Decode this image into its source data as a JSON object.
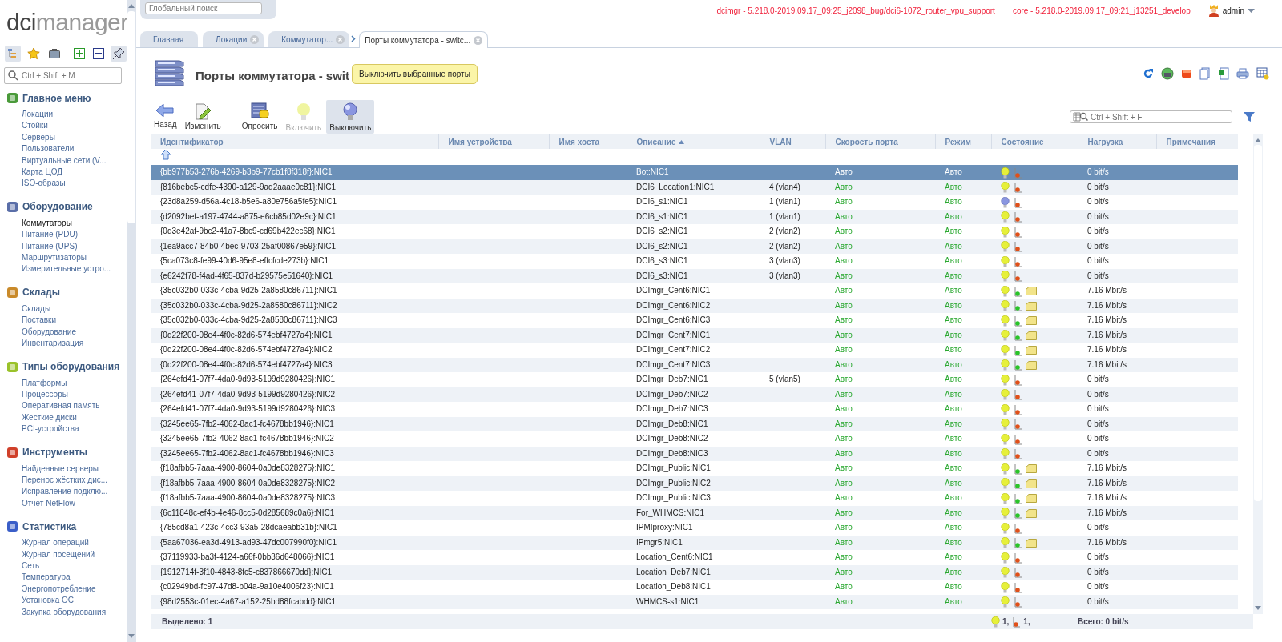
{
  "logo": {
    "strong": "dci",
    "light": "manager"
  },
  "sidebar": {
    "search": {
      "placeholder": "Ctrl + Shift + M"
    },
    "tools": [
      {
        "kind": "tree",
        "selected": true
      },
      {
        "kind": "star",
        "selected": false
      },
      {
        "kind": "case",
        "selected": false
      },
      {
        "kind": "expand",
        "selected": false
      },
      {
        "kind": "collapse",
        "selected": false
      },
      {
        "kind": "pin",
        "selected": true
      }
    ],
    "sections": [
      {
        "title": "Главное меню",
        "items": [
          {
            "label": "Локации",
            "selected": false
          },
          {
            "label": "Стойки",
            "selected": false
          },
          {
            "label": "Серверы",
            "selected": false
          },
          {
            "label": "Пользователи",
            "selected": false
          },
          {
            "label": "Виртуальные сети (V...",
            "selected": false
          },
          {
            "label": "Карта ЦОД",
            "selected": false
          },
          {
            "label": "ISO-образы",
            "selected": false
          }
        ]
      },
      {
        "title": "Оборудование",
        "items": [
          {
            "label": "Коммутаторы",
            "selected": true
          },
          {
            "label": "Питание (PDU)",
            "selected": false
          },
          {
            "label": "Питание (UPS)",
            "selected": false
          },
          {
            "label": "Маршрутизаторы",
            "selected": false
          },
          {
            "label": "Измерительные устро...",
            "selected": false
          }
        ]
      },
      {
        "title": "Склады",
        "items": [
          {
            "label": "Склады",
            "selected": false
          },
          {
            "label": "Поставки",
            "selected": false
          },
          {
            "label": "Оборудование",
            "selected": false
          },
          {
            "label": "Инвентаризация",
            "selected": false
          }
        ]
      },
      {
        "title": "Типы оборудования",
        "items": [
          {
            "label": "Платформы",
            "selected": false
          },
          {
            "label": "Процессоры",
            "selected": false
          },
          {
            "label": "Оперативная память",
            "selected": false
          },
          {
            "label": "Жесткие диски",
            "selected": false
          },
          {
            "label": "PCI-устройства",
            "selected": false
          }
        ]
      },
      {
        "title": "Инструменты",
        "items": [
          {
            "label": "Найденные серверы",
            "selected": false
          },
          {
            "label": "Перенос жёстких дис...",
            "selected": false
          },
          {
            "label": "Исправление подклю...",
            "selected": false
          },
          {
            "label": "Отчет NetFlow",
            "selected": false
          }
        ]
      },
      {
        "title": "Статистика",
        "items": [
          {
            "label": "Журнал операций",
            "selected": false
          },
          {
            "label": "Журнал посещений",
            "selected": false
          },
          {
            "label": "Сеть",
            "selected": false
          },
          {
            "label": "Температура",
            "selected": false
          },
          {
            "label": "Энергопотребление",
            "selected": false
          },
          {
            "label": "Установка ОС",
            "selected": false
          },
          {
            "label": "Закупка оборудования",
            "selected": false
          }
        ]
      }
    ]
  },
  "global_search": {
    "placeholder": "Глобальный поиск"
  },
  "versions": [
    "dcimgr - 5.218.0-2019.09.17_09:25_j2098_bug/dci6-1072_router_vpu_support",
    "core - 5.218.0-2019.09.17_09:21_j13251_develop"
  ],
  "user": "admin",
  "tabs": [
    {
      "label": "Главная",
      "closable": false,
      "selected": false
    },
    {
      "label": "Локации",
      "closable": true,
      "selected": false
    },
    {
      "label": "Коммутатор...",
      "closable": true,
      "selected": false
    },
    {
      "label": "Порты коммутатора - switc...",
      "closable": true,
      "selected": true
    }
  ],
  "page_title": "Порты коммутатора - swit",
  "tooltip": "Выключить выбранные порты",
  "toolbar": [
    {
      "kind": "back",
      "label": "Назад",
      "disabled": false,
      "hover": false
    },
    {
      "kind": "edit",
      "label": "Изменить",
      "disabled": false,
      "hover": false
    },
    {
      "kind": "poll",
      "label": "Опросить",
      "disabled": false,
      "hover": false
    },
    {
      "kind": "on",
      "label": "Включить",
      "disabled": true,
      "hover": false
    },
    {
      "kind": "off",
      "label": "Выключить",
      "disabled": false,
      "hover": true
    }
  ],
  "table_search": {
    "placeholder": "Ctrl + Shift + F"
  },
  "columns": [
    {
      "label": "Идентификатор",
      "sorted": false
    },
    {
      "label": "Имя устройства",
      "sorted": false
    },
    {
      "label": "Имя хоста",
      "sorted": false
    },
    {
      "label": "Описание",
      "sorted": true
    },
    {
      "label": "VLAN",
      "sorted": false
    },
    {
      "label": "Скорость порта",
      "sorted": false
    },
    {
      "label": "Режим",
      "sorted": false
    },
    {
      "label": "Состояние",
      "sorted": false
    },
    {
      "label": "Нагрузка",
      "sorted": false
    },
    {
      "label": "Примечания",
      "sorted": false
    }
  ],
  "rows": [
    {
      "id": "{bb977b53-276b-4269-b3b9-77cb1f8f318f}:NIC1",
      "desc": "Bot:NIC1",
      "vlan": "",
      "speed": "Авто",
      "mode": "Авто",
      "power": true,
      "link": false,
      "traffic": false,
      "load": "0 bit/s",
      "selected": true
    },
    {
      "id": "{816bebc5-cdfe-4390-a129-9ad2aaae0c81}:NIC1",
      "desc": "DCI6_Location1:NIC1",
      "vlan": "4 (vlan4)",
      "speed": "Авто",
      "mode": "Авто",
      "power": true,
      "link": false,
      "traffic": false,
      "load": "0 bit/s",
      "selected": false
    },
    {
      "id": "{23d8a259-d56a-4c18-b5e6-a80e756a5fe5}:NIC1",
      "desc": "DCI6_s1:NIC1",
      "vlan": "1 (vlan1)",
      "speed": "Авто",
      "mode": "Авто",
      "power": false,
      "link": false,
      "traffic": false,
      "load": "0 bit/s",
      "selected": false
    },
    {
      "id": "{d2092bef-a197-4744-a875-e6cb85d02e9c}:NIC1",
      "desc": "DCI6_s1:NIC1",
      "vlan": "1 (vlan1)",
      "speed": "Авто",
      "mode": "Авто",
      "power": true,
      "link": false,
      "traffic": false,
      "load": "0 bit/s",
      "selected": false
    },
    {
      "id": "{0d3e42af-9bc2-41a7-8bc9-cd69b422ec68}:NIC1",
      "desc": "DCI6_s2:NIC1",
      "vlan": "2 (vlan2)",
      "speed": "Авто",
      "mode": "Авто",
      "power": true,
      "link": false,
      "traffic": false,
      "load": "0 bit/s",
      "selected": false
    },
    {
      "id": "{1ea9acc7-84b0-4bec-9703-25af00867e59}:NIC1",
      "desc": "DCI6_s2:NIC1",
      "vlan": "2 (vlan2)",
      "speed": "Авто",
      "mode": "Авто",
      "power": true,
      "link": false,
      "traffic": false,
      "load": "0 bit/s",
      "selected": false
    },
    {
      "id": "{5ca073c8-fe99-40d6-95e8-effcfcde273b}:NIC1",
      "desc": "DCI6_s3:NIC1",
      "vlan": "3 (vlan3)",
      "speed": "Авто",
      "mode": "Авто",
      "power": true,
      "link": false,
      "traffic": false,
      "load": "0 bit/s",
      "selected": false
    },
    {
      "id": "{e6242f78-f4ad-4f65-837d-b29575e51640}:NIC1",
      "desc": "DCI6_s3:NIC1",
      "vlan": "3 (vlan3)",
      "speed": "Авто",
      "mode": "Авто",
      "power": true,
      "link": false,
      "traffic": false,
      "load": "0 bit/s",
      "selected": false
    },
    {
      "id": "{35c032b0-033c-4cba-9d25-2a8580c86711}:NIC1",
      "desc": "DCImgr_Cent6:NIC1",
      "vlan": "",
      "speed": "Авто",
      "mode": "Авто",
      "power": true,
      "link": true,
      "traffic": true,
      "load": "7.16 Mbit/s",
      "selected": false
    },
    {
      "id": "{35c032b0-033c-4cba-9d25-2a8580c86711}:NIC2",
      "desc": "DCImgr_Cent6:NIC2",
      "vlan": "",
      "speed": "Авто",
      "mode": "Авто",
      "power": true,
      "link": true,
      "traffic": true,
      "load": "7.16 Mbit/s",
      "selected": false
    },
    {
      "id": "{35c032b0-033c-4cba-9d25-2a8580c86711}:NIC3",
      "desc": "DCImgr_Cent6:NIC3",
      "vlan": "",
      "speed": "Авто",
      "mode": "Авто",
      "power": true,
      "link": true,
      "traffic": true,
      "load": "7.16 Mbit/s",
      "selected": false
    },
    {
      "id": "{0d22f200-08e4-4f0c-82d6-574ebf4727a4}:NIC1",
      "desc": "DCImgr_Cent7:NIC1",
      "vlan": "",
      "speed": "Авто",
      "mode": "Авто",
      "power": true,
      "link": true,
      "traffic": true,
      "load": "7.16 Mbit/s",
      "selected": false
    },
    {
      "id": "{0d22f200-08e4-4f0c-82d6-574ebf4727a4}:NIC2",
      "desc": "DCImgr_Cent7:NIC2",
      "vlan": "",
      "speed": "Авто",
      "mode": "Авто",
      "power": true,
      "link": true,
      "traffic": true,
      "load": "7.16 Mbit/s",
      "selected": false
    },
    {
      "id": "{0d22f200-08e4-4f0c-82d6-574ebf4727a4}:NIC3",
      "desc": "DCImgr_Cent7:NIC3",
      "vlan": "",
      "speed": "Авто",
      "mode": "Авто",
      "power": true,
      "link": true,
      "traffic": true,
      "load": "7.16 Mbit/s",
      "selected": false
    },
    {
      "id": "{264efd41-07f7-4da0-9d93-5199d9280426}:NIC1",
      "desc": "DCImgr_Deb7:NIC1",
      "vlan": "5 (vlan5)",
      "speed": "Авто",
      "mode": "Авто",
      "power": true,
      "link": false,
      "traffic": false,
      "load": "0 bit/s",
      "selected": false
    },
    {
      "id": "{264efd41-07f7-4da0-9d93-5199d9280426}:NIC2",
      "desc": "DCImgr_Deb7:NIC2",
      "vlan": "",
      "speed": "Авто",
      "mode": "Авто",
      "power": true,
      "link": false,
      "traffic": false,
      "load": "0 bit/s",
      "selected": false
    },
    {
      "id": "{264efd41-07f7-4da0-9d93-5199d9280426}:NIC3",
      "desc": "DCImgr_Deb7:NIC3",
      "vlan": "",
      "speed": "Авто",
      "mode": "Авто",
      "power": true,
      "link": false,
      "traffic": false,
      "load": "0 bit/s",
      "selected": false
    },
    {
      "id": "{3245ee65-7fb2-4062-8ac1-fc4678bb1946}:NIC1",
      "desc": "DCImgr_Deb8:NIC1",
      "vlan": "",
      "speed": "Авто",
      "mode": "Авто",
      "power": true,
      "link": false,
      "traffic": false,
      "load": "0 bit/s",
      "selected": false
    },
    {
      "id": "{3245ee65-7fb2-4062-8ac1-fc4678bb1946}:NIC2",
      "desc": "DCImgr_Deb8:NIC2",
      "vlan": "",
      "speed": "Авто",
      "mode": "Авто",
      "power": true,
      "link": false,
      "traffic": false,
      "load": "0 bit/s",
      "selected": false
    },
    {
      "id": "{3245ee65-7fb2-4062-8ac1-fc4678bb1946}:NIC3",
      "desc": "DCImgr_Deb8:NIC3",
      "vlan": "",
      "speed": "Авто",
      "mode": "Авто",
      "power": true,
      "link": false,
      "traffic": false,
      "load": "0 bit/s",
      "selected": false
    },
    {
      "id": "{f18afbb5-7aaa-4900-8604-0a0de8328275}:NIC1",
      "desc": "DCImgr_Public:NIC1",
      "vlan": "",
      "speed": "Авто",
      "mode": "Авто",
      "power": true,
      "link": true,
      "traffic": true,
      "load": "7.16 Mbit/s",
      "selected": false
    },
    {
      "id": "{f18afbb5-7aaa-4900-8604-0a0de8328275}:NIC2",
      "desc": "DCImgr_Public:NIC2",
      "vlan": "",
      "speed": "Авто",
      "mode": "Авто",
      "power": true,
      "link": true,
      "traffic": true,
      "load": "7.16 Mbit/s",
      "selected": false
    },
    {
      "id": "{f18afbb5-7aaa-4900-8604-0a0de8328275}:NIC3",
      "desc": "DCImgr_Public:NIC3",
      "vlan": "",
      "speed": "Авто",
      "mode": "Авто",
      "power": true,
      "link": true,
      "traffic": true,
      "load": "7.16 Mbit/s",
      "selected": false
    },
    {
      "id": "{6c11848c-ef4b-4e46-8cc5-0d285689c0a6}:NIC1",
      "desc": "For_WHMCS:NIC1",
      "vlan": "",
      "speed": "Авто",
      "mode": "Авто",
      "power": true,
      "link": true,
      "traffic": true,
      "load": "7.16 Mbit/s",
      "selected": false
    },
    {
      "id": "{785cd8a1-423c-4cc3-93a5-28dcaeabb31b}:NIC1",
      "desc": "IPMIproxy:NIC1",
      "vlan": "",
      "speed": "Авто",
      "mode": "Авто",
      "power": true,
      "link": false,
      "traffic": false,
      "load": "0 bit/s",
      "selected": false
    },
    {
      "id": "{5aa67036-ea3d-4913-ad93-47dc007990f0}:NIC1",
      "desc": "IPmgr5:NIC1",
      "vlan": "",
      "speed": "Авто",
      "mode": "Авто",
      "power": true,
      "link": true,
      "traffic": true,
      "load": "7.16 Mbit/s",
      "selected": false
    },
    {
      "id": "{37119933-ba3f-4124-a66f-0bb36d648066}:NIC1",
      "desc": "Location_Cent6:NIC1",
      "vlan": "",
      "speed": "Авто",
      "mode": "Авто",
      "power": true,
      "link": false,
      "traffic": false,
      "load": "0 bit/s",
      "selected": false
    },
    {
      "id": "{1912714f-3f10-4843-8fc5-c837866670dd}:NIC1",
      "desc": "Location_Deb7:NIC1",
      "vlan": "",
      "speed": "Авто",
      "mode": "Авто",
      "power": true,
      "link": false,
      "traffic": false,
      "load": "0 bit/s",
      "selected": false
    },
    {
      "id": "{c02949bd-fc97-47d8-b04a-9a10e4006f23}:NIC1",
      "desc": "Location_Deb8:NIC1",
      "vlan": "",
      "speed": "Авто",
      "mode": "Авто",
      "power": true,
      "link": false,
      "traffic": false,
      "load": "0 bit/s",
      "selected": false
    },
    {
      "id": "{98d2553c-01ec-4a67-a152-25bd88fcabdd}:NIC1",
      "desc": "WHMCS-s1:NIC1",
      "vlan": "",
      "speed": "Авто",
      "mode": "Авто",
      "power": true,
      "link": false,
      "traffic": false,
      "load": "0 bit/s",
      "selected": false
    }
  ],
  "footer": {
    "selected": "Выделено: 1",
    "power_count": "1,",
    "link_count": "1,",
    "total": "Всего: 0 bit/s"
  }
}
